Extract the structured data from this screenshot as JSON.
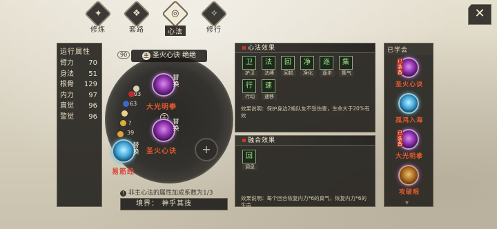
{
  "tabs": [
    {
      "label": "修炼",
      "icon": "cultivate-icon",
      "glyph": "✦"
    },
    {
      "label": "套路",
      "icon": "routine-icon",
      "glyph": "❖"
    },
    {
      "label": "心法",
      "icon": "mind-method-icon",
      "glyph": "◎"
    },
    {
      "label": "修行",
      "icon": "practice-icon",
      "glyph": "✧"
    }
  ],
  "close": "✕",
  "attributes": {
    "title": "运行属性",
    "rows": [
      {
        "name": "臂力",
        "value": "70"
      },
      {
        "name": "身法",
        "value": "51"
      },
      {
        "name": "根骨",
        "value": "129"
      },
      {
        "name": "内力",
        "value": "97"
      },
      {
        "name": "直觉",
        "value": "96"
      },
      {
        "name": "警觉",
        "value": "96"
      }
    ]
  },
  "center": {
    "badge": "90",
    "header_icon": "主",
    "header": "圣火心诀 绝绝",
    "gem_labels": [
      "93",
      "63",
      "?",
      "39"
    ],
    "skills": [
      {
        "name": "大光明拳",
        "swap": "替换"
      },
      {
        "name": "圣火心诀",
        "swap": "替换"
      },
      {
        "name": "易筋经",
        "swap": "替换"
      }
    ],
    "main_mark": "主",
    "empty_slot_icon": "+",
    "note_icon": "!",
    "note": "非主心法的属性加成系数为1/3",
    "realm": "境界：  神乎其技"
  },
  "mind_effect": {
    "title": "心法效果",
    "buffs": [
      {
        "glyph": "卫",
        "label": "护卫"
      },
      {
        "glyph": "法",
        "label": "法缚"
      },
      {
        "glyph": "回",
        "label": "回损"
      },
      {
        "glyph": "净",
        "label": "净化"
      },
      {
        "glyph": "逐",
        "label": "逐步"
      },
      {
        "glyph": "集",
        "label": "集气"
      },
      {
        "glyph": "行",
        "label": "行动"
      },
      {
        "glyph": "速",
        "label": "速移"
      }
    ],
    "desc": "效果说明：保护身边2格队友不受伤害，生命大于20%有效"
  },
  "fusion_effect": {
    "title": "融合效果",
    "buffs": [
      {
        "glyph": "回",
        "label": "调息"
      }
    ],
    "desc": "效果说明：每个回合恢复内力*6的真气，恢复内力*6的生命"
  },
  "learned": {
    "title": "已学会",
    "items": [
      {
        "name": "圣火心诀",
        "tag": "已装备"
      },
      {
        "name": "孤鸿入海",
        "tag": ""
      },
      {
        "name": "大光明拳",
        "tag": "已装备"
      },
      {
        "name": "攻破眼",
        "tag": ""
      }
    ],
    "more": "▾"
  },
  "colors": {
    "skill_name": "#e35a2f",
    "buff_border": "#8ea27c",
    "panel_bg": "#2a2824"
  }
}
